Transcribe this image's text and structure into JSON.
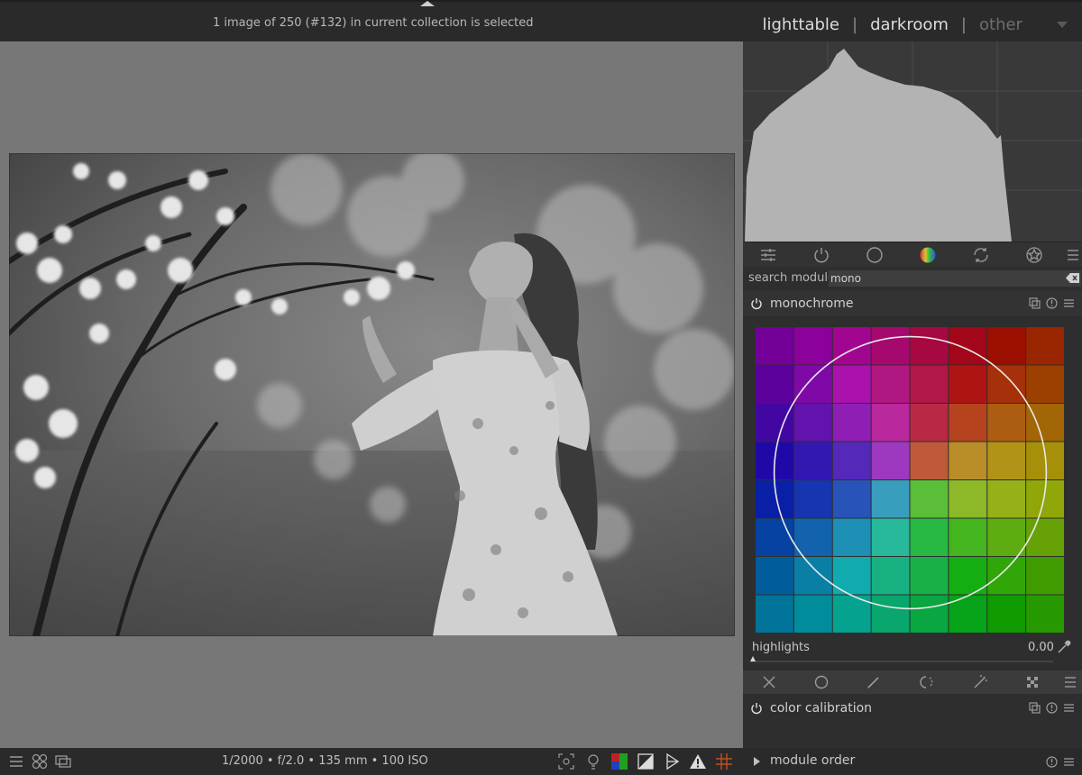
{
  "header": {
    "status": "1 image of 250 (#132) in current collection is selected",
    "views": {
      "lighttable": "lighttable",
      "darkroom": "darkroom",
      "other": "other",
      "separator": "|"
    }
  },
  "footer": {
    "exif": "1/2000 • f/2.0 • 135 mm • 100 ISO"
  },
  "right_panel": {
    "search": {
      "label": "search module",
      "value": "mono"
    },
    "module_tabs": [
      "quick-access-icon",
      "power-icon",
      "circle-icon",
      "color-wheel-icon",
      "refresh-icon",
      "favorites-icon",
      "menu-icon"
    ],
    "monochrome": {
      "title": "monochrome",
      "highlights_label": "highlights",
      "highlights_value": "0.00",
      "highlights_level": 0.0
    },
    "color_calibration": {
      "title": "color calibration"
    },
    "module_order": {
      "label": "module order"
    }
  },
  "colors": {
    "accent": "#d0d0d0",
    "panel": "#2e2e2e",
    "canvas": "#777777"
  }
}
